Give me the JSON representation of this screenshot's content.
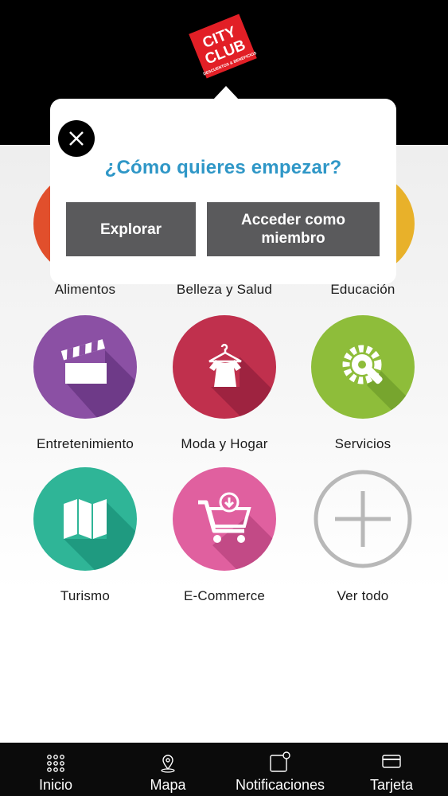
{
  "brand": {
    "logo_line1": "CITY",
    "logo_line2": "CLUB",
    "logo_line3": "DESCUENTOS & BENEFICIOS",
    "logo_color": "#e21f26"
  },
  "modal": {
    "title": "¿Cómo quieres empezar?",
    "explore_label": "Explorar",
    "member_label_line1": "Acceder como",
    "member_label_line2": "miembro",
    "accent_color": "#2f97c7"
  },
  "categories": [
    {
      "label": "Alimentos",
      "icon": "food-icon",
      "color": "#e14f2c"
    },
    {
      "label": "Belleza y Salud",
      "icon": "beauty-icon",
      "color": "#d83a5c"
    },
    {
      "label": "Educación",
      "icon": "education-icon",
      "color": "#e8b12a"
    },
    {
      "label": "Entretenimiento",
      "icon": "clapperboard-icon",
      "color": "#8b50a4"
    },
    {
      "label": "Moda y Hogar",
      "icon": "shirt-hanger-icon",
      "color": "#c0304d"
    },
    {
      "label": "Servicios",
      "icon": "tools-gear-icon",
      "color": "#8ebd3a"
    },
    {
      "label": "Turismo",
      "icon": "map-icon",
      "color": "#2fb597"
    },
    {
      "label": "E-Commerce",
      "icon": "shopping-cart-icon",
      "color": "#e0609f"
    },
    {
      "label": "Ver todo",
      "icon": "plus-icon",
      "color": "#b8b8b8"
    }
  ],
  "tabbar": {
    "items": [
      {
        "label": "Inicio",
        "icon": "grid-icon"
      },
      {
        "label": "Mapa",
        "icon": "map-pin-icon"
      },
      {
        "label": "Notificaciones",
        "icon": "notification-icon"
      },
      {
        "label": "Tarjeta",
        "icon": "card-icon"
      }
    ]
  }
}
